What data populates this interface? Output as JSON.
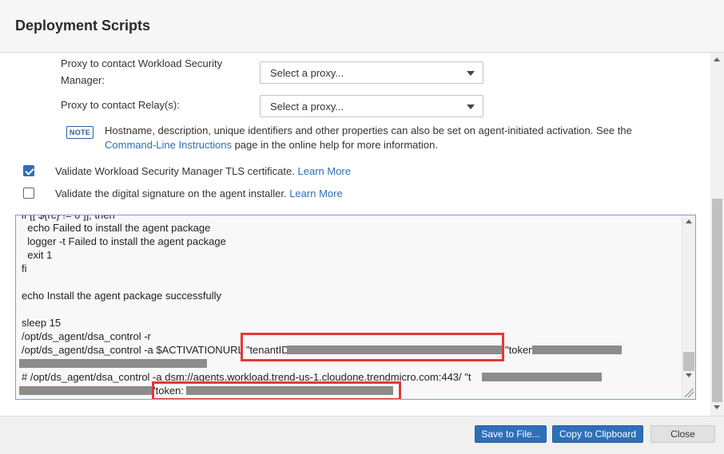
{
  "dialog": {
    "title": "Deployment Scripts"
  },
  "proxy": {
    "manager_label": "Proxy to contact Workload Security Manager:",
    "manager_value": "Select a proxy...",
    "relay_label": "Proxy to contact Relay(s):",
    "relay_value": "Select a proxy..."
  },
  "note": {
    "badge": "NOTE",
    "text_before": "Hostname, description, unique identifiers and other properties can also be set on agent-initiated activation. See the ",
    "link": "Command-Line Instructions",
    "text_after": " page in the online help for more information."
  },
  "options": [
    {
      "label": "Validate Workload Security Manager TLS certificate.",
      "link": "Learn More",
      "checked": true
    },
    {
      "label": "Validate the digital signature on the agent installer.",
      "link": "Learn More",
      "checked": false
    }
  ],
  "script": {
    "partial_top": "if [[ ${rc} != 0 ]]; then",
    "echo_fail": "  echo Failed to install the agent package",
    "logger_fail": "  logger -t Failed to install the agent package",
    "exit": "  exit 1",
    "fi": "fi",
    "echo_success": "echo Install the agent package successfully",
    "sleep": "sleep 15",
    "reset": "/opt/ds_agent/dsa_control -r",
    "activate_prefix": "/opt/ds_agent/dsa_control -a $ACTIVATIONURL \"tenantID",
    "activate_token": "\"token",
    "comment_line": "# /opt/ds_agent/dsa_control -a dsm://agents.workload.trend-us-1.cloudone.trendmicro.com:443/ \"t",
    "comment_token": "\"token:"
  },
  "footer": {
    "save": "Save to File...",
    "copy": "Copy to Clipboard",
    "close": "Close"
  },
  "colors": {
    "accent": "#2f6fba",
    "highlight": "#e53935",
    "redaction": "#8c8c8c"
  }
}
